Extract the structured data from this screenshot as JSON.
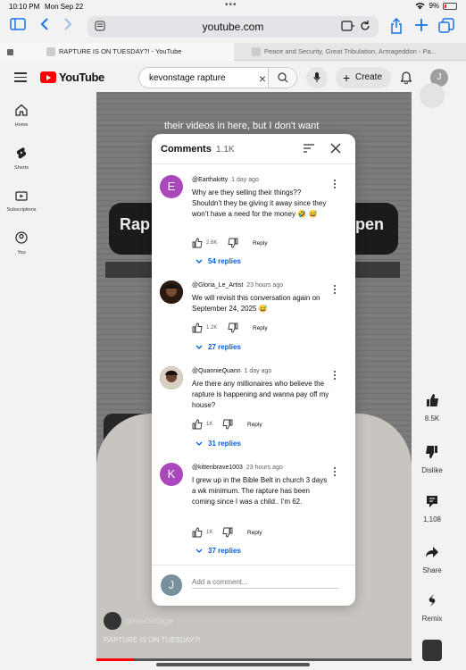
{
  "status_bar": {
    "time": "10:10 PM",
    "date": "Mon Sep 22",
    "battery": "9%"
  },
  "browser": {
    "url": "youtube.com",
    "tabs": [
      {
        "title": "RAPTURE IS ON TUESDAY?! - YouTube",
        "active": true
      },
      {
        "title": "Peace and Security, Great Tribulation, Armageddon - Pa...",
        "active": false
      }
    ]
  },
  "youtube": {
    "logo": "YouTube",
    "search_query": "kevonstage rapture",
    "create_label": "Create",
    "avatar_letter": "J",
    "nav": [
      {
        "label": "Home",
        "icon": "home-icon"
      },
      {
        "label": "Shorts",
        "icon": "shorts-icon"
      },
      {
        "label": "Subscriptions",
        "icon": "subscriptions-icon"
      },
      {
        "label": "You",
        "icon": "you-icon"
      }
    ],
    "video": {
      "caption": "their videos in here, but I don't want",
      "banner_left": "Rap",
      "banner_right": "pen",
      "channel": "@KevOnStage",
      "title": "RAPTURE IS ON TUESDAY?!",
      "progress": 0.12
    },
    "actions": [
      {
        "label": "8.5K",
        "icon": "like-icon"
      },
      {
        "label": "Dislike",
        "icon": "dislike-icon"
      },
      {
        "label": "1,108",
        "icon": "comment-icon"
      },
      {
        "label": "Share",
        "icon": "share-icon"
      },
      {
        "label": "Remix",
        "icon": "remix-icon"
      }
    ]
  },
  "comments_panel": {
    "title": "Comments",
    "count": "1.1K",
    "add_placeholder": "Add a comment...",
    "user_letter": "J",
    "comments": [
      {
        "author": "@Earthakitty",
        "age": "1 day ago",
        "avatar_letter": "E",
        "avatar_color": "#ab47bc",
        "text": "Why are they selling their things?? Shouldn’t they be giving it away since they won’t have a need for the money 🤣 😅",
        "likes": "2.6K",
        "reply": "Reply",
        "replies": "54 replies"
      },
      {
        "author": "@Gloria_Le_Artist",
        "age": "23 hours ago",
        "avatar_letter": "",
        "avatar_color": "#2b1a12",
        "text": "We will revisit this conversation again on September 24, 2025 😅",
        "likes": "1.2K",
        "reply": "Reply",
        "replies": "27 replies"
      },
      {
        "author": "@QuannieQuann",
        "age": "1 day ago",
        "avatar_letter": "",
        "avatar_color": "#5a3a2a",
        "text": "Are there any millionaires who believe the rapture is happening and wanna pay off my house?",
        "likes": "1K",
        "reply": "Reply",
        "replies": "31 replies"
      },
      {
        "author": "@kittenbrave1003",
        "age": "23 hours ago",
        "avatar_letter": "K",
        "avatar_color": "#ab47bc",
        "text": "I grew up in the Bible Belt in church 3 days a wk minimum. The rapture has been coming since I was a child.. I'm 62.",
        "likes": "1K",
        "reply": "Reply",
        "replies": "37 replies"
      }
    ]
  }
}
